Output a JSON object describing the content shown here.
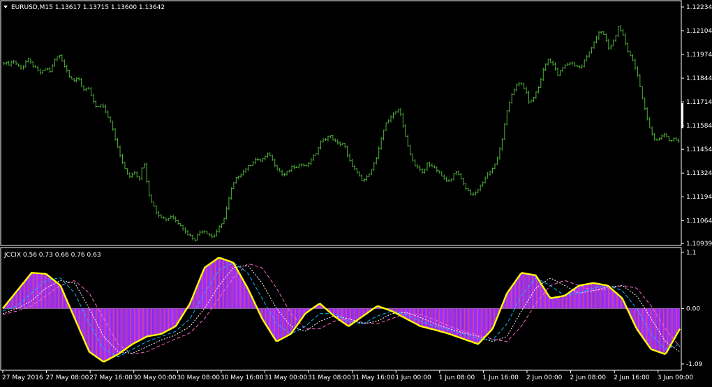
{
  "chart_data": [
    {
      "type": "bar",
      "subtype": "ohlc",
      "symbol_info": {
        "title": "EURUSD,M15  1.13617 1.13715 1.13600 1.13642",
        "open": 1.13617,
        "high": 1.13715,
        "low": 1.136,
        "close": 1.13642
      },
      "ylim": [
        1.10939,
        1.12234
      ],
      "yticks": [
        "1.12234",
        "1.12104",
        "1.11974",
        "1.11844",
        "1.11714",
        "1.11584",
        "1.11454",
        "1.11324",
        "1.11194",
        "1.11064",
        "1.10939"
      ],
      "bar_color": "#4faf3b",
      "closes": [
        1.1193,
        1.1192,
        1.1194,
        1.1191,
        1.119,
        1.1195,
        1.1192,
        1.1189,
        1.1187,
        1.119,
        1.1188,
        1.1195,
        1.1197,
        1.1191,
        1.1186,
        1.1183,
        1.1184,
        1.1178,
        1.118,
        1.1172,
        1.1168,
        1.117,
        1.1165,
        1.116,
        1.115,
        1.1142,
        1.1135,
        1.113,
        1.1133,
        1.1128,
        1.114,
        1.1122,
        1.1115,
        1.111,
        1.1108,
        1.1107,
        1.1109,
        1.1106,
        1.1104,
        1.11,
        1.1098,
        1.1096,
        1.11,
        1.1101,
        1.1099,
        1.1097,
        1.1102,
        1.1105,
        1.1115,
        1.1125,
        1.113,
        1.1132,
        1.1135,
        1.1137,
        1.114,
        1.1139,
        1.1141,
        1.1143,
        1.1138,
        1.1134,
        1.1131,
        1.1133,
        1.1136,
        1.1135,
        1.1138,
        1.1136,
        1.114,
        1.1143,
        1.1149,
        1.1151,
        1.1153,
        1.115,
        1.1148,
        1.1149,
        1.114,
        1.1136,
        1.1132,
        1.1128,
        1.113,
        1.1135,
        1.114,
        1.115,
        1.116,
        1.1162,
        1.1166,
        1.1168,
        1.1155,
        1.1145,
        1.1138,
        1.1135,
        1.1132,
        1.1138,
        1.1136,
        1.1134,
        1.1131,
        1.1128,
        1.1129,
        1.1133,
        1.1131,
        1.1125,
        1.1122,
        1.112,
        1.1124,
        1.1128,
        1.1132,
        1.1135,
        1.114,
        1.115,
        1.1165,
        1.1175,
        1.118,
        1.1182,
        1.1178,
        1.117,
        1.1175,
        1.118,
        1.119,
        1.1195,
        1.1192,
        1.1186,
        1.119,
        1.1192,
        1.1193,
        1.1191,
        1.119,
        1.1195,
        1.12,
        1.1205,
        1.121,
        1.1208,
        1.12,
        1.1205,
        1.1212,
        1.1208,
        1.12,
        1.1195,
        1.1188,
        1.1175,
        1.1165,
        1.1155,
        1.115,
        1.1152,
        1.1154,
        1.115,
        1.1151,
        1.115
      ]
    },
    {
      "type": "bar",
      "indicator_title": "JCCIX 0.56 0.73 0.66 0.76 0.63",
      "ylim": [
        -1.09,
        1.1
      ],
      "yticks": [
        "1.1",
        "0.00",
        "-1.09"
      ],
      "histogram_color": "#9b30ff",
      "series": [
        {
          "name": "JCCIX",
          "color": "#ffff00",
          "values": [
            0.0,
            0.35,
            0.7,
            0.68,
            0.45,
            -0.2,
            -0.85,
            -1.05,
            -0.9,
            -0.7,
            -0.55,
            -0.5,
            -0.35,
            0.1,
            0.8,
            1.0,
            0.9,
            0.4,
            -0.2,
            -0.65,
            -0.5,
            -0.1,
            0.1,
            -0.15,
            -0.35,
            -0.15,
            0.05,
            -0.05,
            -0.2,
            -0.35,
            -0.42,
            -0.5,
            -0.6,
            -0.7,
            -0.4,
            0.3,
            0.7,
            0.65,
            0.2,
            0.25,
            0.45,
            0.5,
            0.45,
            0.2,
            -0.4,
            -0.8,
            -0.9,
            -0.4
          ]
        },
        {
          "color": "#00bfff",
          "values": [
            -0.05,
            0.05,
            0.3,
            0.55,
            0.6,
            0.3,
            -0.3,
            -0.8,
            -0.95,
            -0.8,
            -0.65,
            -0.55,
            -0.45,
            -0.2,
            0.3,
            0.75,
            0.9,
            0.7,
            0.2,
            -0.3,
            -0.5,
            -0.35,
            -0.1,
            -0.1,
            -0.25,
            -0.3,
            -0.15,
            -0.05,
            -0.12,
            -0.25,
            -0.35,
            -0.42,
            -0.5,
            -0.6,
            -0.62,
            -0.3,
            0.25,
            0.6,
            0.45,
            0.25,
            0.3,
            0.4,
            0.45,
            0.35,
            0.0,
            -0.5,
            -0.8,
            -0.7
          ]
        },
        {
          "color": "#ffffff",
          "values": [
            -0.1,
            0.0,
            0.15,
            0.4,
            0.55,
            0.5,
            0.0,
            -0.55,
            -0.85,
            -0.88,
            -0.75,
            -0.62,
            -0.52,
            -0.35,
            0.0,
            0.45,
            0.8,
            0.85,
            0.5,
            0.0,
            -0.35,
            -0.45,
            -0.25,
            -0.15,
            -0.2,
            -0.3,
            -0.25,
            -0.1,
            -0.08,
            -0.18,
            -0.3,
            -0.4,
            -0.48,
            -0.55,
            -0.65,
            -0.55,
            -0.05,
            0.4,
            0.6,
            0.45,
            0.3,
            0.35,
            0.42,
            0.45,
            0.25,
            -0.2,
            -0.65,
            -0.85
          ]
        },
        {
          "color": "#ff66cc",
          "values": [
            -0.12,
            -0.05,
            0.05,
            0.25,
            0.45,
            0.55,
            0.3,
            -0.2,
            -0.7,
            -0.9,
            -0.85,
            -0.72,
            -0.6,
            -0.48,
            -0.2,
            0.2,
            0.6,
            0.88,
            0.8,
            0.4,
            -0.1,
            -0.4,
            -0.4,
            -0.25,
            -0.2,
            -0.28,
            -0.3,
            -0.2,
            -0.1,
            -0.12,
            -0.22,
            -0.35,
            -0.45,
            -0.52,
            -0.6,
            -0.65,
            -0.35,
            0.1,
            0.45,
            0.55,
            0.45,
            0.35,
            0.38,
            0.45,
            0.4,
            0.05,
            -0.4,
            -0.75
          ]
        }
      ]
    }
  ],
  "x_axis": {
    "labels": [
      "27 May 2016",
      "27 May 08:00",
      "27 May 16:00",
      "30 May 00:00",
      "30 May 08:00",
      "30 May 16:00",
      "31 May 00:00",
      "31 May 08:00",
      "31 May 16:00",
      "1 Jun 00:00",
      "1 Jun 08:00",
      "1 Jun 16:00",
      "2 Jun 00:00",
      "2 Jun 08:00",
      "2 Jun 16:00",
      "3 Jun 00:00"
    ]
  },
  "colors": {
    "background": "#000000",
    "grid": "#ffffff",
    "text": "#ffffff"
  }
}
